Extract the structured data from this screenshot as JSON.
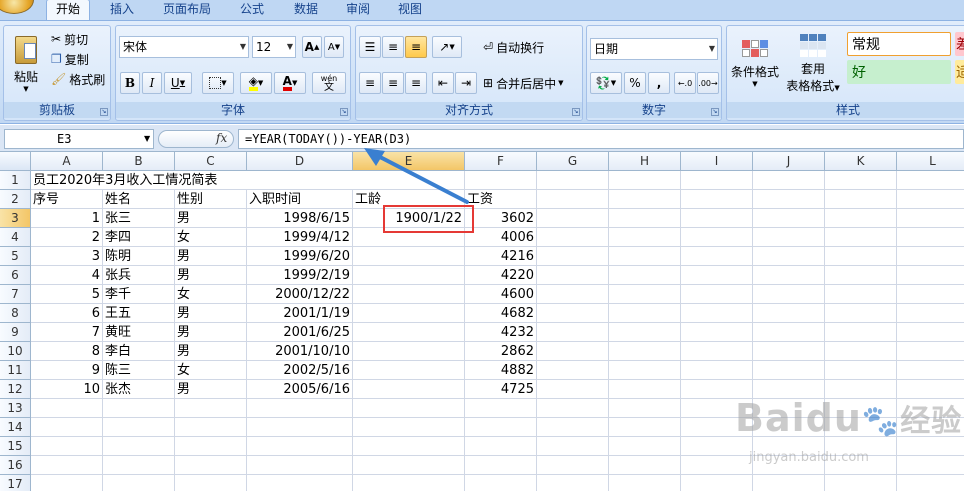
{
  "tabs": [
    {
      "label": "开始",
      "active": true
    },
    {
      "label": "插入"
    },
    {
      "label": "页面布局"
    },
    {
      "label": "公式"
    },
    {
      "label": "数据"
    },
    {
      "label": "审阅"
    },
    {
      "label": "视图"
    }
  ],
  "ribbon": {
    "clipboard": {
      "paste": "粘贴",
      "cut": "剪切",
      "copy": "复制",
      "format_painter": "格式刷",
      "label": "剪贴板"
    },
    "font": {
      "name": "宋体",
      "size": "12",
      "label": "字体",
      "wen": "wén",
      "wen_char": "文"
    },
    "alignment": {
      "wrap": "自动换行",
      "merge": "合并后居中",
      "label": "对齐方式"
    },
    "number": {
      "format": "日期",
      "percent": "%",
      "comma": ",",
      "label": "数字"
    },
    "styles": {
      "conditional_line1": "条件格式",
      "table_line1": "套用",
      "table_line2": "表格格式",
      "normal": "常规",
      "good": "好",
      "bad_partial": "差",
      "neutral_partial": "适",
      "label": "样式"
    }
  },
  "formula_bar": {
    "name_box": "E3",
    "fx": "fx",
    "formula": "=YEAR(TODAY())-YEAR(D3)"
  },
  "columns": [
    "A",
    "B",
    "C",
    "D",
    "E",
    "F",
    "G",
    "H",
    "I",
    "J",
    "K",
    "L"
  ],
  "rows": [
    [
      "员工2020年3月收入工情况简表",
      "",
      "",
      "",
      "",
      ""
    ],
    [
      "序号",
      "姓名",
      "性别",
      "入职时间",
      "工龄",
      "工资"
    ],
    [
      "1",
      "张三",
      "男",
      "1998/6/15",
      "1900/1/22",
      "3602"
    ],
    [
      "2",
      "李四",
      "女",
      "1999/4/12",
      "",
      "4006"
    ],
    [
      "3",
      "陈明",
      "男",
      "1999/6/20",
      "",
      "4216"
    ],
    [
      "4",
      "张兵",
      "男",
      "1999/2/19",
      "",
      "4220"
    ],
    [
      "5",
      "李千",
      "女",
      "2000/12/22",
      "",
      "4600"
    ],
    [
      "6",
      "王五",
      "男",
      "2001/1/19",
      "",
      "4682"
    ],
    [
      "7",
      "黄旺",
      "男",
      "2001/6/25",
      "",
      "4232"
    ],
    [
      "8",
      "李白",
      "男",
      "2001/10/10",
      "",
      "2862"
    ],
    [
      "9",
      "陈三",
      "女",
      "2002/5/16",
      "",
      "4882"
    ],
    [
      "10",
      "张杰",
      "男",
      "2005/6/16",
      "",
      "4725"
    ],
    [
      "",
      "",
      "",
      "",
      "",
      ""
    ],
    [
      "",
      "",
      "",
      "",
      "",
      ""
    ],
    [
      "",
      "",
      "",
      "",
      "",
      ""
    ],
    [
      "",
      "",
      "",
      "",
      "",
      ""
    ],
    [
      "",
      "",
      "",
      "",
      "",
      ""
    ]
  ],
  "row_numbers": [
    "1",
    "2",
    "3",
    "4",
    "5",
    "6",
    "7",
    "8",
    "9",
    "10",
    "11",
    "12",
    "13",
    "14",
    "15",
    "16",
    "17"
  ],
  "watermark": {
    "brand": "Baidu",
    "brand_cn": "经验",
    "url": "jingyan.baidu.com"
  },
  "colors": {
    "highlight": "#e53935",
    "arrow": "#3a7fd0",
    "ribbon": "#dbe6f5",
    "accent": "#15428b"
  }
}
